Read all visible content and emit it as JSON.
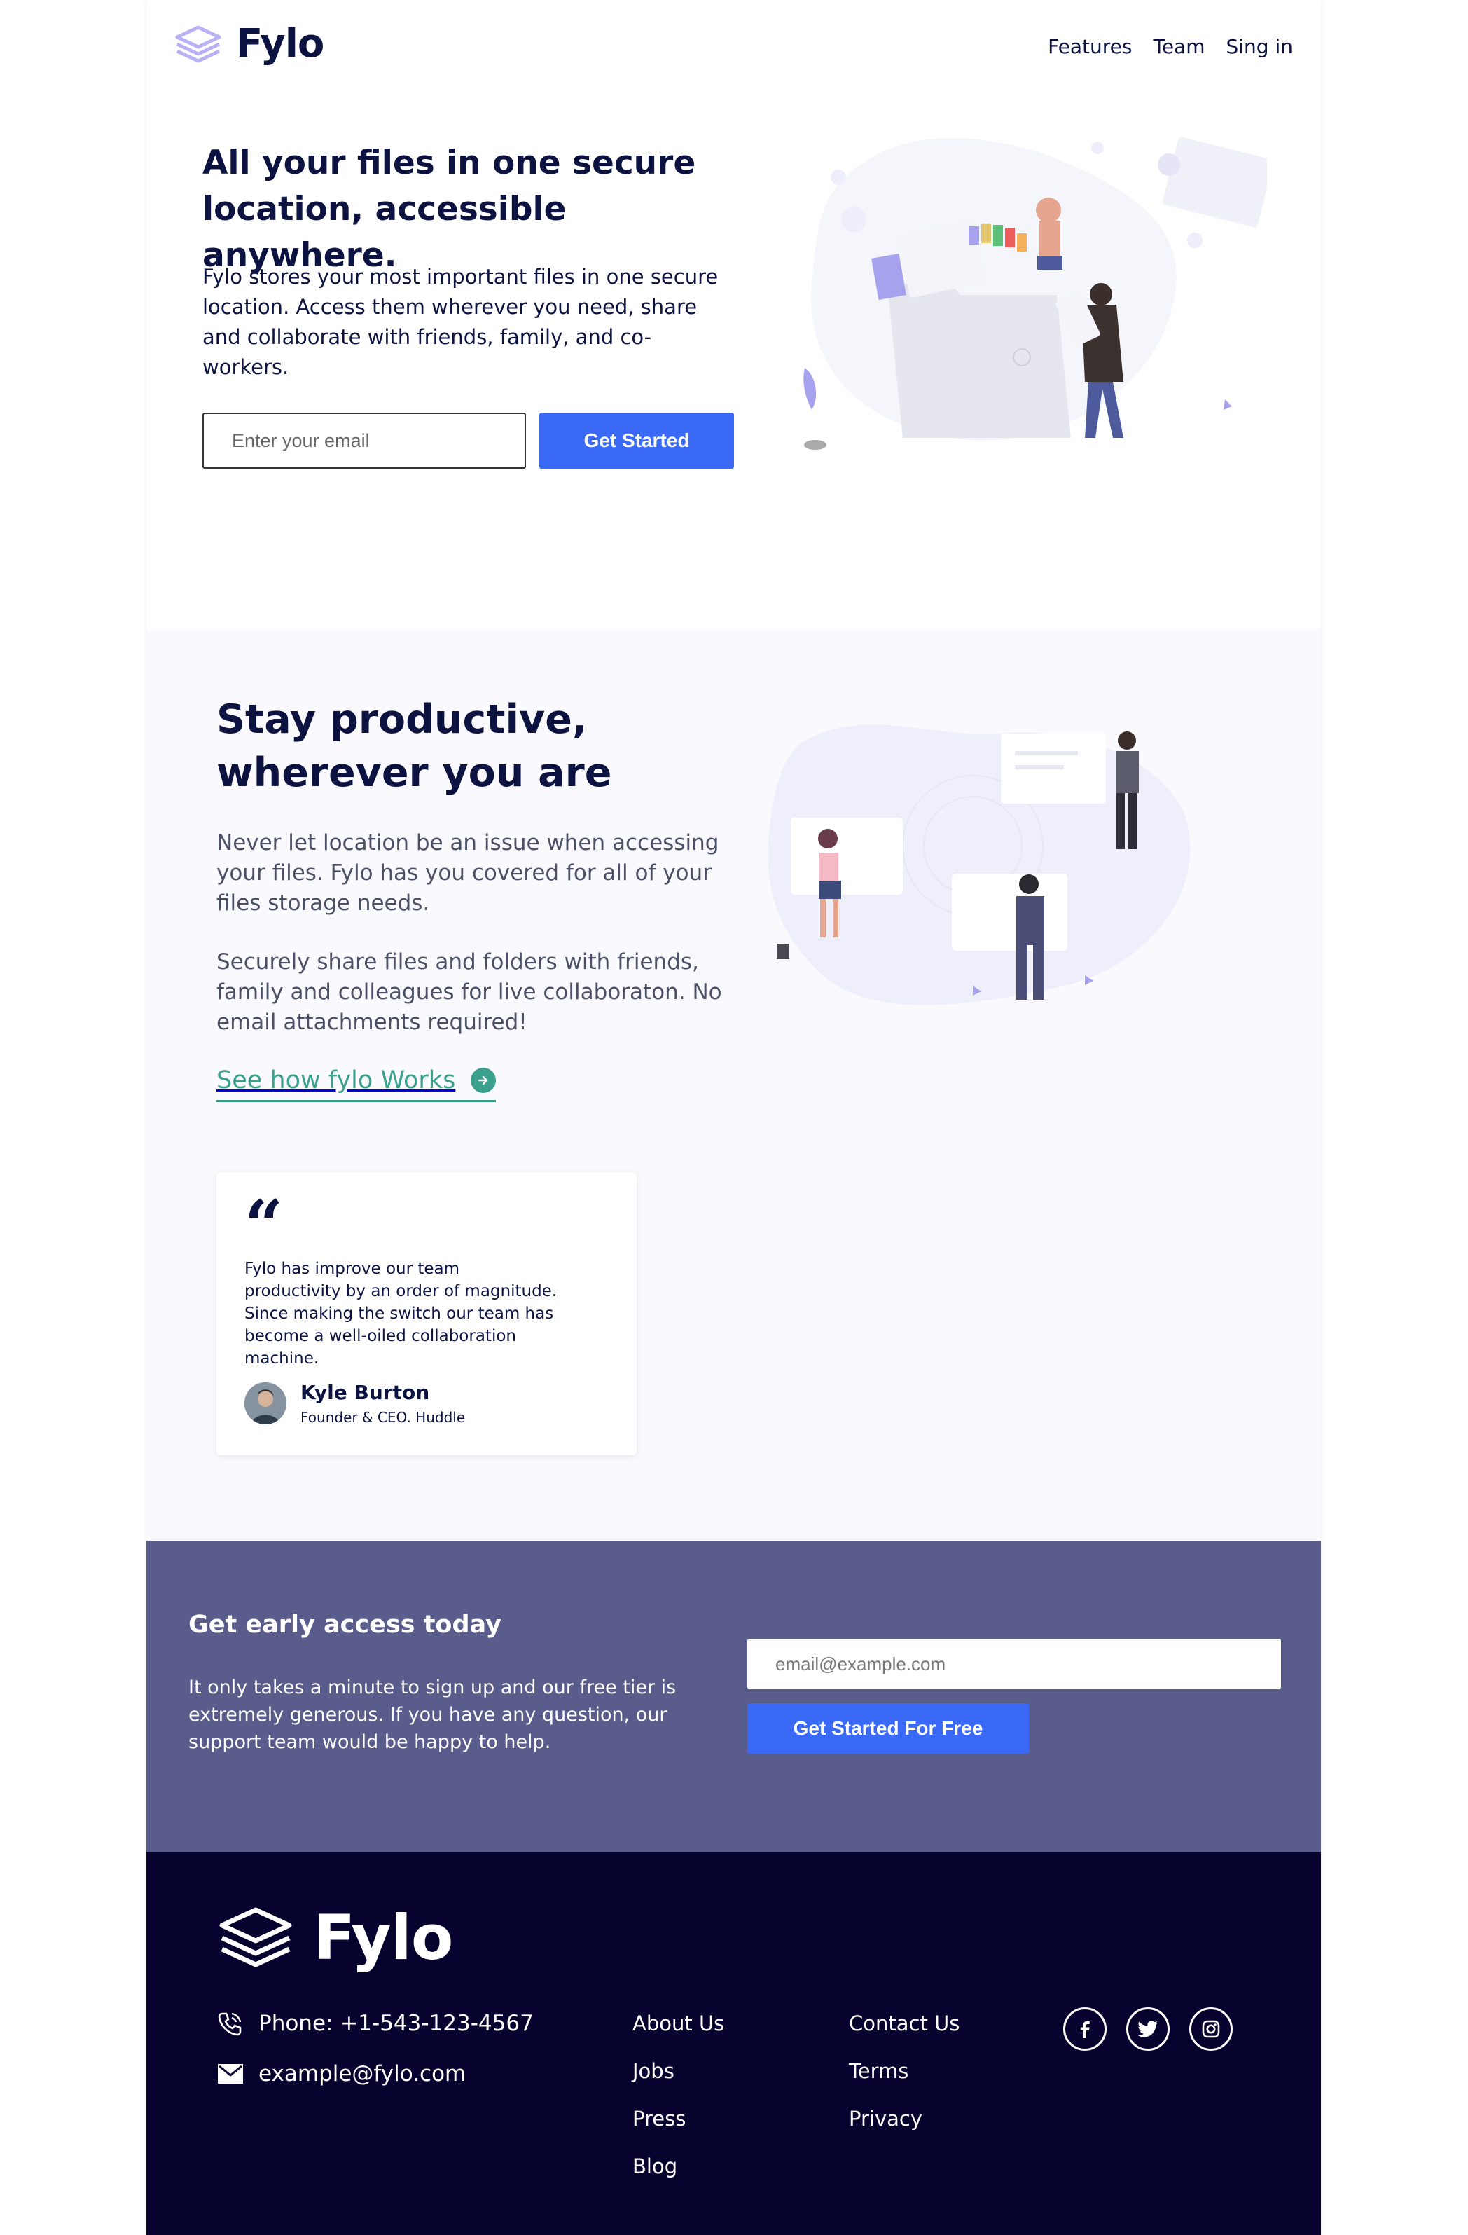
{
  "header": {
    "logo_text": "Fylo",
    "nav": [
      "Features",
      "Team",
      "Sing in"
    ]
  },
  "hero": {
    "title": "All your files in one secure location, accessible anywhere.",
    "text": "Fylo stores your most important files in one secure location. Access them wherever you need, share and collaborate with friends, family, and co-workers.",
    "email_placeholder": "Enter your email",
    "button_label": "Get Started"
  },
  "productive": {
    "title": "Stay productive, wherever you are",
    "paragraph_1": "Never let location be an issue when accessing your files. Fylo has you covered for all of your files storage needs.",
    "paragraph_2": "Securely share files and folders with friends, family and colleagues for live collaboraton. No email attachments required!",
    "link_label": "See how fylo Works"
  },
  "testimonial": {
    "quote_mark": "“",
    "text": "Fylo has improve our team productivity by an order of magnitude. Since making the switch our team has become a well-oiled collaboration machine.",
    "name": "Kyle Burton",
    "role": "Founder & CEO. Huddle"
  },
  "early_access": {
    "title": "Get early access today",
    "text": "It only takes a minute to sign up and our free tier is extremely generous. If you have any question, our support team would be happy to help.",
    "email_placeholder": "email@example.com",
    "button_label": "Get Started For Free"
  },
  "footer": {
    "logo_text": "Fylo",
    "phone": "Phone: +1-543-123-4567",
    "email": "example@fylo.com",
    "links_col_1": [
      "About Us",
      "Jobs",
      "Press",
      "Blog"
    ],
    "links_col_2": [
      "Contact Us",
      "Terms",
      "Privacy"
    ],
    "socials": [
      "facebook-icon",
      "twitter-icon",
      "instagram-icon"
    ]
  },
  "colors": {
    "primary_blue": "#3a69f5",
    "accent_teal": "#3ba18d",
    "navy": "#0c1340",
    "early_bg": "#5a5c8c",
    "footer_bg": "#06032e",
    "section_bg": "#f9f9fe"
  }
}
